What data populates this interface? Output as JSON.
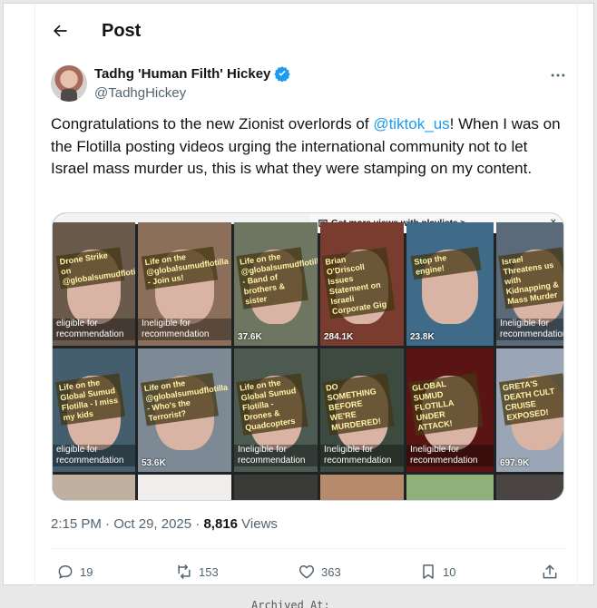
{
  "header": {
    "title": "Post",
    "back_icon": "arrow-left-icon"
  },
  "author": {
    "display_name": "Tadhg 'Human Filth' Hickey",
    "handle": "@TadhgHickey",
    "verified": true,
    "verified_color": "#1d9bf0"
  },
  "tweet": {
    "text_before": "Congratulations to the new Zionist overlords of ",
    "mention": "@tiktok_us",
    "text_after": "! When I was on the Flotilla posting videos urging the international community not to let Israel mass murder us, this is what they were stamping on my content.",
    "accent_color": "#1d9bf0"
  },
  "media": {
    "playlist_text": "Get more views with playlists >",
    "close_glyph": "×",
    "tiles": [
      {
        "caption": "Drone Strike on @globalsumudflotilla",
        "overlay": "eligible for recommendation",
        "bg": "#6a5a4c"
      },
      {
        "caption": "Life on the @globalsumudflotilla - Join us!",
        "overlay": "Ineligible for recommendation",
        "bg": "#8b6f5a"
      },
      {
        "caption": "Life on the @globalsumudflotilla - Band of brothers & sister",
        "overlay": "37.6K",
        "bg": "#6e7560",
        "views": true
      },
      {
        "caption": "Brian O'Driscoll Issues Statement on Israeli Corporate Gig",
        "overlay": "284.1K",
        "bg": "#7a3c2f",
        "views": true
      },
      {
        "caption": "Stop the engine!",
        "overlay": "23.8K",
        "bg": "#3f6a88",
        "views": true
      },
      {
        "caption": "Israel Threatens us with Kidnapping & Mass Murder",
        "overlay": "Ineligible for recommendation",
        "bg": "#5b6a78"
      },
      {
        "caption": "Life on the Global Sumud Flotilla - I miss my kids",
        "overlay": "eligible for recommendation",
        "bg": "#455e6e"
      },
      {
        "caption": "Life on the @globalsumudflotilla - Who's the Terrorist?",
        "overlay": "53.6K",
        "bg": "#7d8a96",
        "views": true
      },
      {
        "caption": "Life on the Global Sumud Flotilla - Drones & Quadcopters",
        "overlay": "Ineligible for recommendation",
        "bg": "#4c5a52"
      },
      {
        "caption": "DO SOMETHING BEFORE WE'RE MURDERED!",
        "overlay": "Ineligible for recommendation",
        "bg": "#3c4a40"
      },
      {
        "caption": "GLOBAL SUMUD FLOTILLA UNDER ATTACK!",
        "overlay": "Ineligible for recommendation",
        "bg": "#5a1414"
      },
      {
        "caption": "GRETA'S DEATH CULT CRUISE EXPOSED!",
        "overlay": "697.9K",
        "bg": "#9aa6b6",
        "views": true
      }
    ]
  },
  "meta": {
    "time": "2:15 PM",
    "dot": " · ",
    "date": "Oct 29, 2025",
    "dot2": " · ",
    "views_count": "8,816",
    "views_label": " Views"
  },
  "actions": {
    "replies": "19",
    "reposts": "153",
    "likes": "363",
    "bookmarks": "10"
  },
  "footer": {
    "archived_label": "Archived At:"
  }
}
